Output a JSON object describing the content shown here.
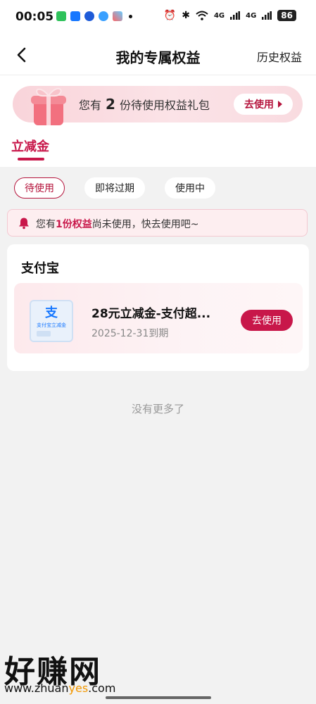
{
  "status_bar": {
    "time": "00:05",
    "network": "4G",
    "network2": "4G",
    "battery": "86"
  },
  "header": {
    "title": "我的专属权益",
    "history_label": "历史权益"
  },
  "banner": {
    "text_prefix": "您有",
    "count": "2",
    "text_suffix": "份待使用权益礼包",
    "button_label": "去使用"
  },
  "tabs": [
    {
      "label": "立减金",
      "active": true
    }
  ],
  "filters": [
    {
      "label": "待使用",
      "active": true
    },
    {
      "label": "即将过期",
      "active": false
    },
    {
      "label": "使用中",
      "active": false
    }
  ],
  "notice": {
    "prefix": "您有",
    "highlight": "1份权益",
    "suffix": "尚未使用，快去使用吧~"
  },
  "card": {
    "title": "支付宝",
    "coupon": {
      "name": "28元立减金-支付超...",
      "expiry": "2025-12-31到期",
      "button_label": "去使用",
      "thumb_text": "支付宝立减金"
    }
  },
  "no_more_text": "没有更多了",
  "watermark": {
    "logo": "好赚网",
    "url_prefix": "www.zhuan",
    "url_highlight": "yes",
    "url_suffix": ".com"
  },
  "colors": {
    "accent": "#c8174a",
    "alipay_blue": "#1677ff",
    "banner_pink": "#f9d4da"
  }
}
